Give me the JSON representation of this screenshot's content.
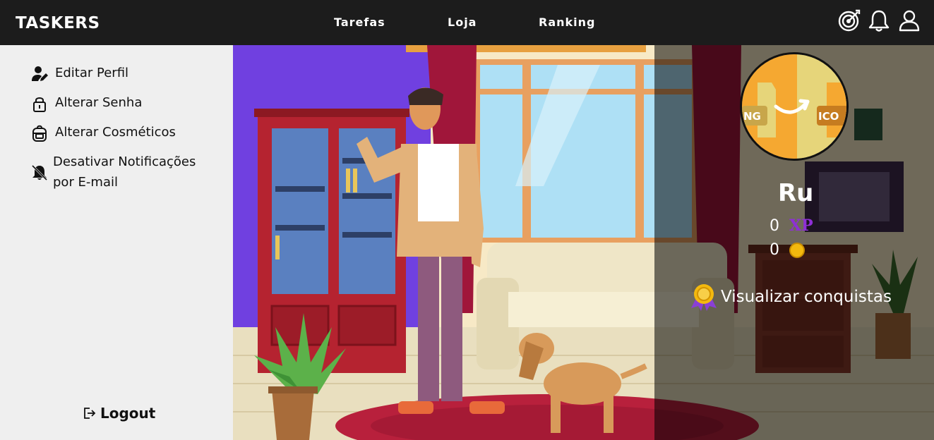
{
  "header": {
    "brand": "TASKERS",
    "nav": [
      "Tarefas",
      "Loja",
      "Ranking"
    ],
    "icons": [
      "target-icon",
      "bell-icon",
      "user-icon"
    ]
  },
  "sidebar": {
    "items": [
      {
        "label": "Editar Perfil",
        "icon": "edit-user-icon"
      },
      {
        "label": "Alterar Senha",
        "icon": "lock-icon"
      },
      {
        "label": "Alterar Cosméticos",
        "icon": "backpack-icon"
      },
      {
        "label": "Desativar Notificações por E-mail",
        "icon": "bell-off-icon"
      }
    ],
    "logout": "Logout"
  },
  "profile": {
    "avatar_texts": [
      "NG",
      "ICO"
    ],
    "name": "Ru",
    "xp": "0",
    "xp_label": "XP",
    "coins": "0",
    "achievements": "Visualizar conquistas"
  },
  "colors": {
    "topbar": "#1c1c1c",
    "sidebar": "#efefef",
    "xp": "#8e2fd6",
    "coin": "#f3b90e",
    "scene_wall": "#7040e0",
    "rug": "#b8203c"
  }
}
